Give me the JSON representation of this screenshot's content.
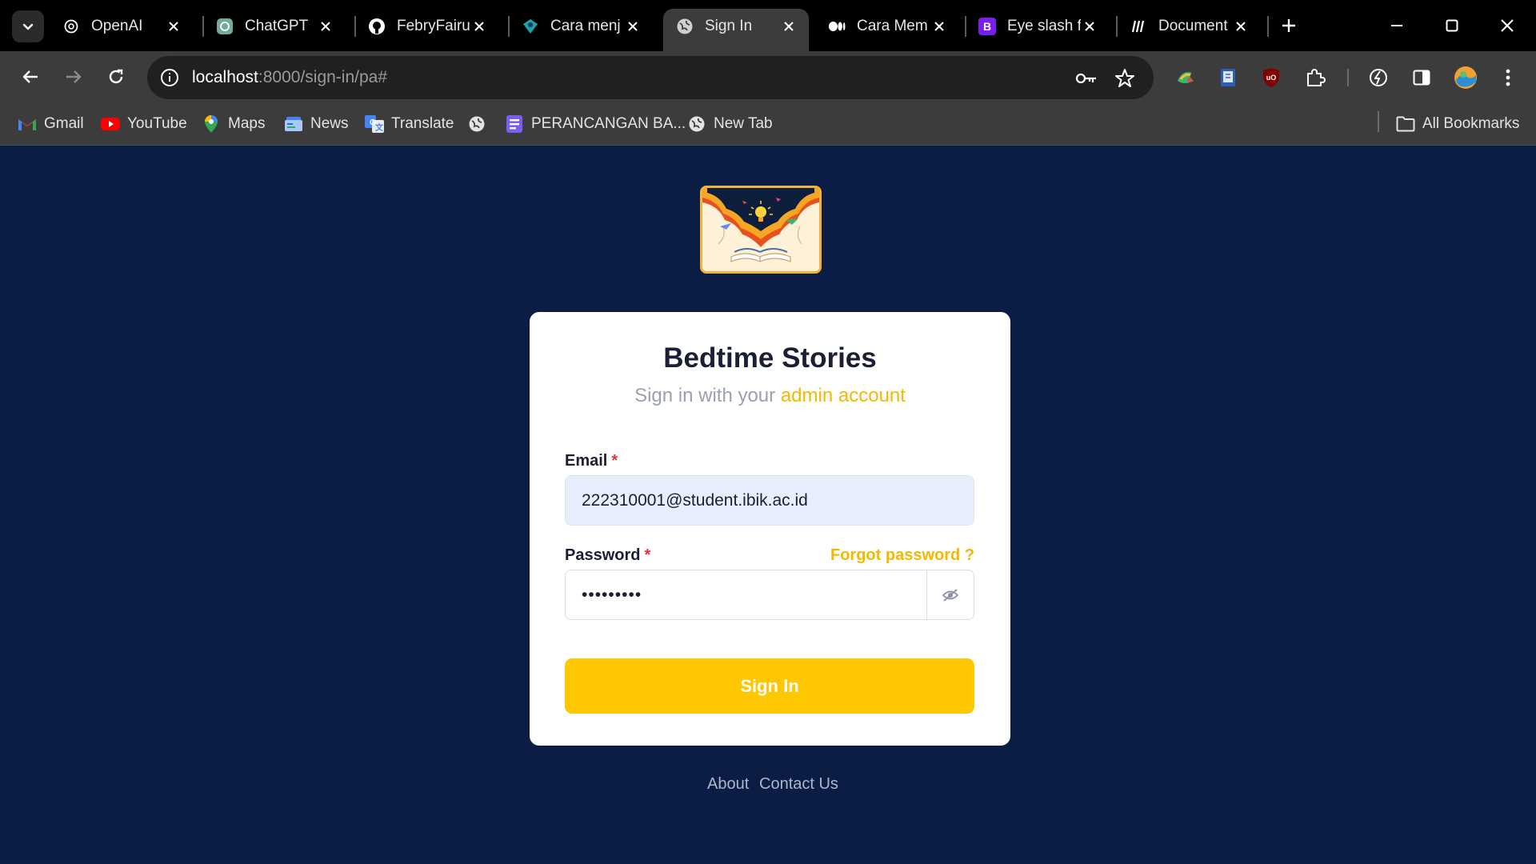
{
  "browser": {
    "tabs": [
      {
        "title": "OpenAI",
        "icon": "openai-icon"
      },
      {
        "title": "ChatGPT",
        "icon": "chatgpt-icon"
      },
      {
        "title": "FebryFairu",
        "icon": "github-icon"
      },
      {
        "title": "Cara menj",
        "icon": "site-icon"
      },
      {
        "title": "Sign In",
        "icon": "globe-icon",
        "active": true
      },
      {
        "title": "Cara Mem",
        "icon": "medium-icon"
      },
      {
        "title": "Eye slash f",
        "icon": "bootstrap-icon"
      },
      {
        "title": "Document",
        "icon": "mdn-icon"
      }
    ],
    "url_host": "localhost",
    "url_path": ":8000/sign-in/pa#",
    "bookmarks": [
      {
        "label": "Gmail",
        "icon": "gmail-icon"
      },
      {
        "label": "YouTube",
        "icon": "youtube-icon"
      },
      {
        "label": "Maps",
        "icon": "maps-icon"
      },
      {
        "label": "News",
        "icon": "news-icon"
      },
      {
        "label": "Translate",
        "icon": "translate-icon"
      },
      {
        "label": "",
        "icon": "globe-icon"
      },
      {
        "label": "PERANCANGAN BA...",
        "icon": "docs-icon"
      },
      {
        "label": "New Tab",
        "icon": "globe-icon"
      }
    ],
    "all_bookmarks": "All Bookmarks"
  },
  "signin_card": {
    "title": "Bedtime Stories",
    "subtitle_prefix": "Sign in with your",
    "subtitle_highlight": "admin account",
    "email_label": "Email",
    "email_value": "222310001@student.ibik.ac.id",
    "password_label": "Password",
    "password_value": "•••••••••",
    "required_mark": "*",
    "forgot_password": "Forgot password ?",
    "submit_label": "Sign In"
  },
  "footer": {
    "links": [
      "About",
      "Contact Us"
    ]
  },
  "colors": {
    "page_background": "#0b1d44",
    "accent": "#ffc700",
    "required": "#e0343a"
  }
}
